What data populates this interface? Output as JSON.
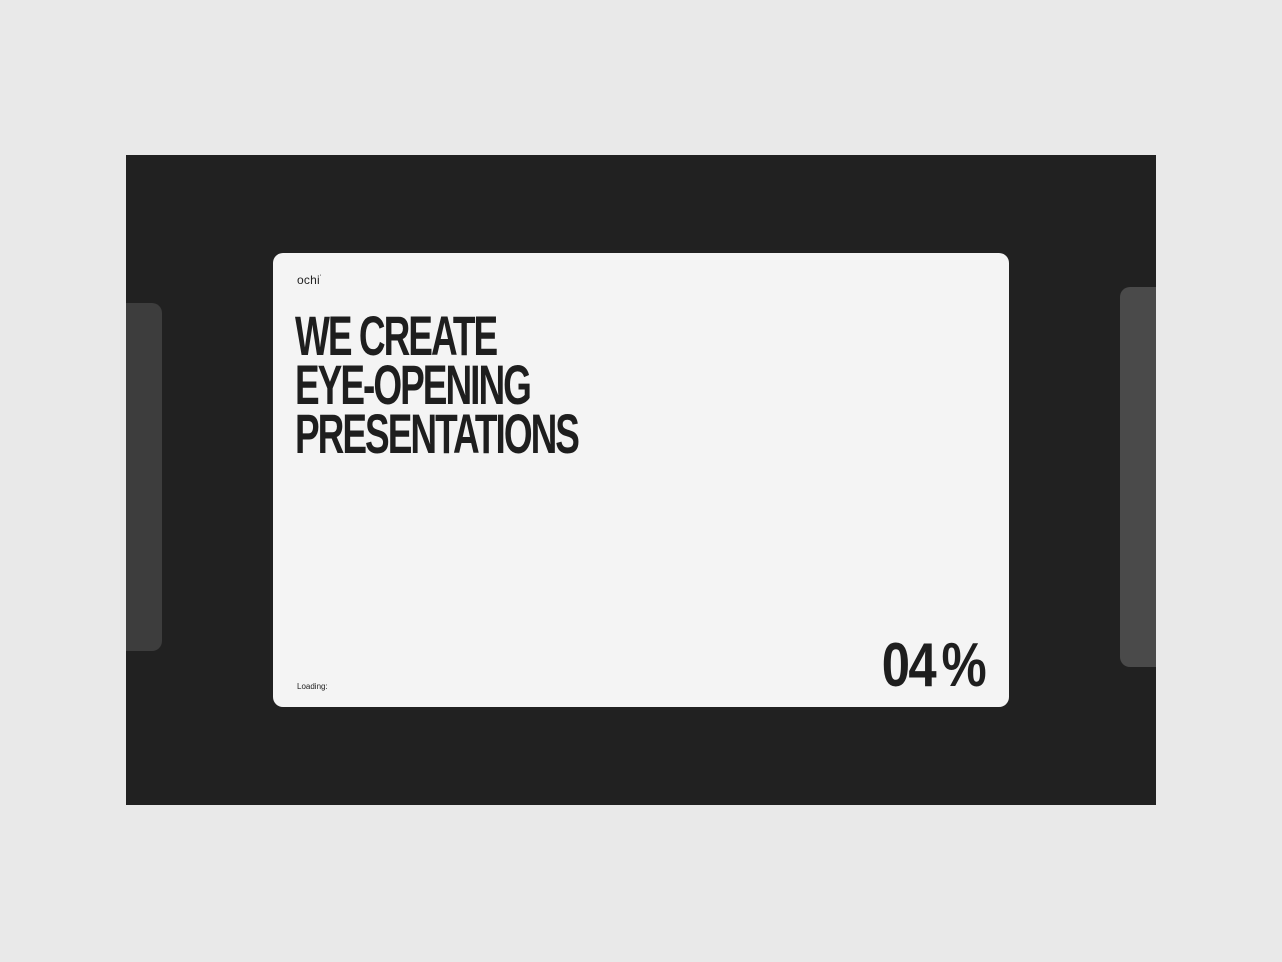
{
  "brand": {
    "name": "ochi",
    "mark": "'"
  },
  "headline": {
    "lines": [
      "WE CREATE",
      "EYE-OPENING",
      "PRESENTATIONS"
    ]
  },
  "loader": {
    "label": "Loading:",
    "value": "04",
    "unit": "%",
    "progress_percent": 4
  },
  "colors": {
    "page_background": "#e9e9e9",
    "stage_background": "#212121",
    "slide_background": "#f4f4f4",
    "text": "#1e1e1e",
    "side_card_left": "#3d3d3d",
    "side_card_right": "#4a4a4a"
  }
}
